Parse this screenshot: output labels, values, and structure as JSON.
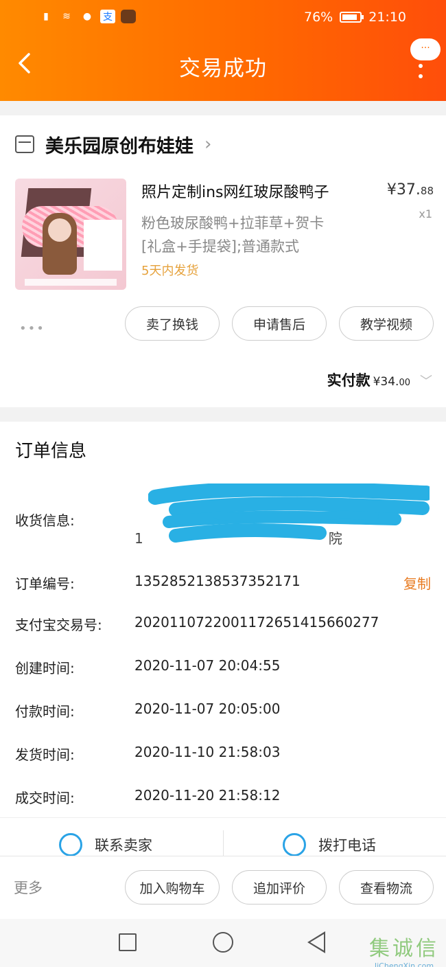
{
  "status_bar": {
    "battery": "76%",
    "time": "21:10"
  },
  "header": {
    "title": "交易成功",
    "bubble": "···"
  },
  "shop": {
    "name": "美乐园原创布娃娃"
  },
  "product": {
    "title": "照片定制ins网红玻尿酸鸭子",
    "price_int": "¥37.",
    "price_dec": "88",
    "qty": "x1",
    "sku_line1": "粉色玻尿酸鸭+拉菲草+贺卡",
    "sku_line2": "[礼盒+手提袋];普通款式",
    "ship": "5天内发货"
  },
  "actions": {
    "dots": "•••",
    "sell": "卖了换钱",
    "aftersale": "申请售后",
    "video": "教学视频"
  },
  "payment": {
    "label": "实付款",
    "amount": "¥34.",
    "amount_dec": "00"
  },
  "order": {
    "section_title": "订单信息",
    "address_label": "收货信息:",
    "address_visible": "1",
    "address_tail": "院",
    "order_no_label": "订单编号:",
    "order_no": "1352852138537352171",
    "copy_label": "复制",
    "alipay_label": "支付宝交易号:",
    "alipay_no": "2020110722001172651415660277",
    "created_label": "创建时间:",
    "created": "2020-11-07 20:04:55",
    "paid_label": "付款时间:",
    "paid": "2020-11-07 20:05:00",
    "shipped_label": "发货时间:",
    "shipped": "2020-11-10 21:58:03",
    "done_label": "成交时间:",
    "done": "2020-11-20 21:58:12"
  },
  "contact": {
    "seller": "联系卖家",
    "call": "拨打电话"
  },
  "bottom": {
    "more": "更多",
    "cart": "加入购物车",
    "review": "追加评价",
    "logistics": "查看物流"
  },
  "watermark": {
    "big": "集诚信",
    "small": "JiChengXin.com"
  },
  "colors": {
    "header_start": "#ff8a00",
    "header_end": "#ff4e0a",
    "accent": "#e87a1f",
    "scribble": "#29b0e4"
  }
}
